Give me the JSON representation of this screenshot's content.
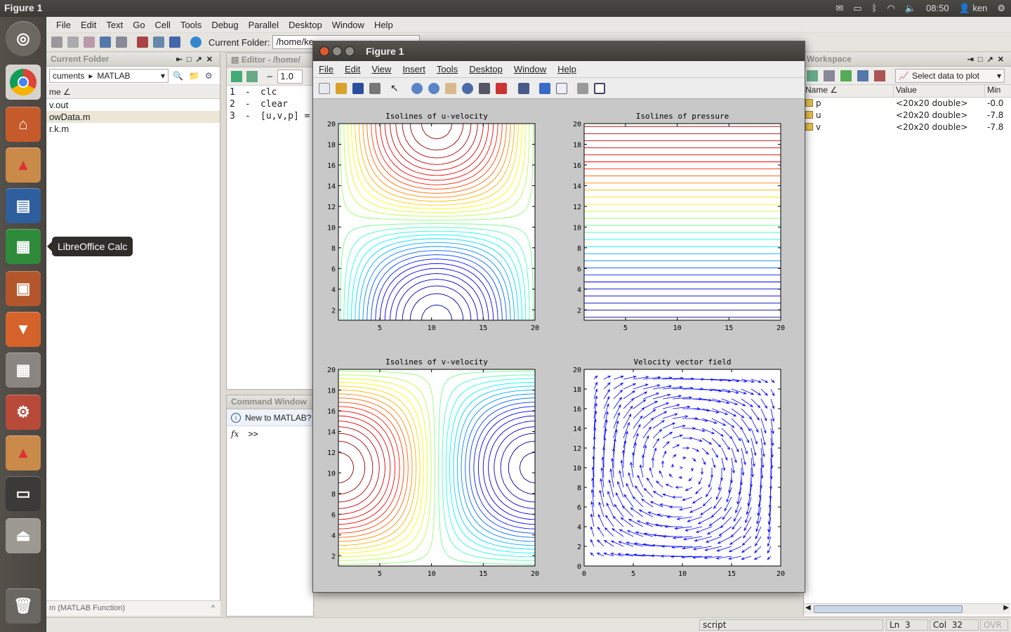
{
  "topbar": {
    "title": "Figure 1",
    "time": "08:50",
    "user": "ken"
  },
  "launcher": {
    "tooltip": "LibreOffice Calc"
  },
  "menubar": {
    "items": [
      "File",
      "Edit",
      "Text",
      "Go",
      "Cell",
      "Tools",
      "Debug",
      "Parallel",
      "Desktop",
      "Window",
      "Help"
    ]
  },
  "toolbar": {
    "current_folder_label": "Current Folder:",
    "current_folder_path": "/home/ke"
  },
  "current_folder": {
    "title": "Current Folder",
    "breadcrumb": [
      "cuments",
      "MATLAB"
    ],
    "column_name": "me",
    "files": [
      "v.out",
      "owData.m",
      "r.k.m"
    ],
    "footer": "m (MATLAB Function)"
  },
  "editor": {
    "title": "Editor - /home/",
    "zoom_value": "1.0",
    "lines": [
      {
        "num": "1",
        "code": "clc"
      },
      {
        "num": "2",
        "code": "clear"
      },
      {
        "num": "3",
        "code": "[u,v,p] ="
      }
    ]
  },
  "command_window": {
    "title": "Command Window",
    "info": "New to MATLAB?",
    "prompt": ">>"
  },
  "workspace": {
    "title": "Workspace",
    "plot_select": "Select data to plot",
    "columns": [
      "Name",
      "Value",
      "Min"
    ],
    "rows": [
      {
        "name": "p",
        "value": "<20x20 double>",
        "min": "-0.0"
      },
      {
        "name": "u",
        "value": "<20x20 double>",
        "min": "-7.8"
      },
      {
        "name": "v",
        "value": "<20x20 double>",
        "min": "-7.8"
      }
    ]
  },
  "statusbar": {
    "mode": "script",
    "ln_label": "Ln",
    "ln": "3",
    "col_label": "Col",
    "col": "32",
    "ovr": "OVR"
  },
  "figure": {
    "title": "Figure 1",
    "menu": [
      "File",
      "Edit",
      "View",
      "Insert",
      "Tools",
      "Desktop",
      "Window",
      "Help"
    ]
  },
  "chart_data": [
    {
      "type": "contour",
      "title": "Isolines of u-velocity",
      "xlim": [
        1,
        20
      ],
      "ylim": [
        1,
        20
      ],
      "xticks": [
        5,
        10,
        15,
        20
      ],
      "yticks": [
        2,
        4,
        6,
        8,
        10,
        12,
        14,
        16,
        18,
        20
      ]
    },
    {
      "type": "contour",
      "title": "Isolines of pressure",
      "xlim": [
        1,
        20
      ],
      "ylim": [
        1,
        20
      ],
      "xticks": [
        5,
        10,
        15,
        20
      ],
      "yticks": [
        2,
        4,
        6,
        8,
        10,
        12,
        14,
        16,
        18,
        20
      ]
    },
    {
      "type": "contour",
      "title": "Isolines of v-velocity",
      "xlim": [
        1,
        20
      ],
      "ylim": [
        1,
        20
      ],
      "xticks": [
        5,
        10,
        15,
        20
      ],
      "yticks": [
        2,
        4,
        6,
        8,
        10,
        12,
        14,
        16,
        18,
        20
      ]
    },
    {
      "type": "quiver",
      "title": "Velocity vector field",
      "xlim": [
        0,
        20
      ],
      "ylim": [
        0,
        20
      ],
      "xticks": [
        0,
        5,
        10,
        15,
        20
      ],
      "yticks": [
        0,
        2,
        4,
        6,
        8,
        10,
        12,
        14,
        16,
        18,
        20
      ],
      "color": "#0000ff"
    }
  ],
  "colors": {
    "contour_map": [
      "#00008f",
      "#0000ff",
      "#00ffff",
      "#ffff00",
      "#ff0000",
      "#800000"
    ]
  }
}
